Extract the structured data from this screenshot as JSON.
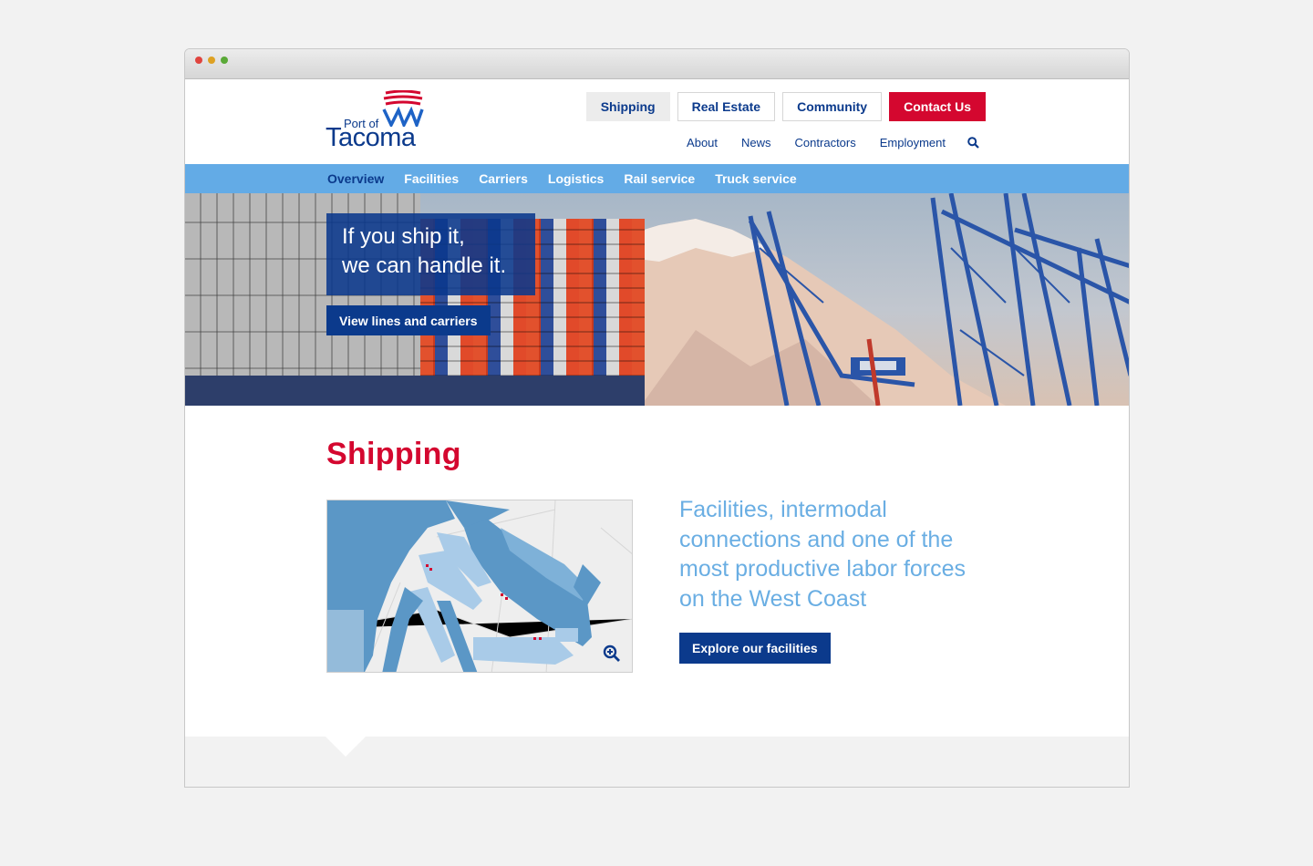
{
  "logo": {
    "line1": "Port of",
    "line2": "Tacoma"
  },
  "top_nav": [
    {
      "label": "Shipping"
    },
    {
      "label": "Real Estate"
    },
    {
      "label": "Community"
    },
    {
      "label": "Contact Us"
    }
  ],
  "utility_nav": [
    {
      "label": "About"
    },
    {
      "label": "News"
    },
    {
      "label": "Contractors"
    },
    {
      "label": "Employment"
    }
  ],
  "icons": {
    "search": "search-icon",
    "zoom": "zoom-in-icon"
  },
  "section_nav": [
    {
      "label": "Overview"
    },
    {
      "label": "Facilities"
    },
    {
      "label": "Carriers"
    },
    {
      "label": "Logistics"
    },
    {
      "label": "Rail service"
    },
    {
      "label": "Truck service"
    }
  ],
  "hero": {
    "headline_line1": "If you ship it,",
    "headline_line2": "we can handle it.",
    "cta": "View lines and carriers"
  },
  "main": {
    "title": "Shipping",
    "blurb": "Facilities, intermodal connections and one of the most productive labor forces on the West Coast",
    "cta": "Explore our facilities"
  },
  "colors": {
    "brand_navy": "#0b3a8c",
    "brand_red": "#d4072f",
    "nav_blue": "#63abe6",
    "blurb_blue": "#6aaee3"
  }
}
